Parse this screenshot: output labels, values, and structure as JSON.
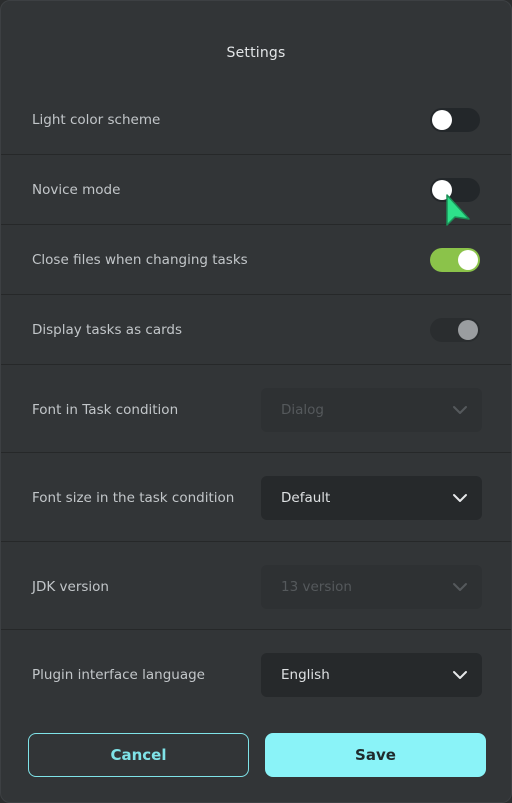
{
  "dialog": {
    "title": "Settings"
  },
  "settings": {
    "light_color_scheme": {
      "label": "Light color scheme",
      "state": "off"
    },
    "novice_mode": {
      "label": "Novice mode",
      "state": "off"
    },
    "close_files": {
      "label": "Close files when changing tasks",
      "state": "on"
    },
    "display_cards": {
      "label": "Display tasks as cards",
      "state": "disabled"
    },
    "font_task_condition": {
      "label": "Font in Task condition",
      "value": "Dialog",
      "enabled": false
    },
    "font_size_task_condition": {
      "label": "Font size in the task condition",
      "value": "Default",
      "enabled": true
    },
    "jdk_version": {
      "label": "JDK version",
      "value": "13 version",
      "enabled": false
    },
    "plugin_language": {
      "label": "Plugin interface language",
      "value": "English",
      "enabled": true
    }
  },
  "buttons": {
    "cancel": "Cancel",
    "save": "Save"
  },
  "colors": {
    "background": "#323537",
    "accent_cyan": "#8af3f8",
    "toggle_on": "#8bc34a",
    "cursor": "#2ee08a"
  },
  "icons": {
    "chevron": "chevron-down-icon",
    "cursor": "mouse-pointer-icon"
  }
}
